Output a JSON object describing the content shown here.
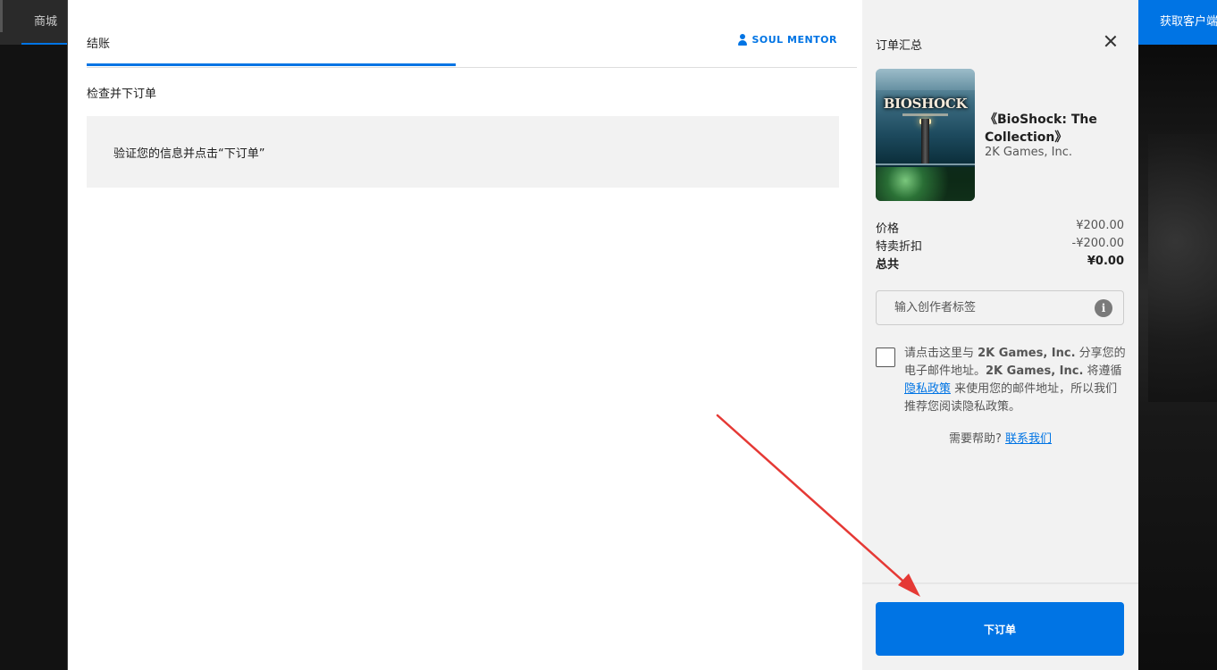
{
  "background": {
    "nav_item": "商城",
    "cta": "获取客户端"
  },
  "checkout": {
    "tab_label": "结账",
    "user_name": "SOUL MENTOR",
    "section_title": "检查并下订单",
    "notice": "验证您的信息并点击“下订单”"
  },
  "summary": {
    "title": "订单汇总",
    "cover_logo": "BIOSHOCK",
    "game_title": "《BioShock: The Collection》",
    "publisher": "2K Games, Inc.",
    "price_label": "价格",
    "price_value": "¥200.00",
    "discount_label": "特卖折扣",
    "discount_value": "-¥200.00",
    "total_label": "总共",
    "total_value": "¥0.00",
    "creator_placeholder": "输入创作者标签",
    "info_icon": "i",
    "consent_part1": "请点击这里与 ",
    "consent_company1": "2K Games, Inc.",
    "consent_part2": " 分享您的电子邮件地址。",
    "consent_company2": "2K Games, Inc.",
    "consent_part3": " 将遵循 ",
    "consent_link": "隐私政策",
    "consent_part4": " 来使用您的邮件地址，所以我们推荐您阅读隐私政策。",
    "help_text": "需要帮助? ",
    "help_link": "联系我们",
    "place_order": "下订单"
  },
  "colors": {
    "accent": "#0074e4",
    "annotation_arrow": "#e53935"
  }
}
